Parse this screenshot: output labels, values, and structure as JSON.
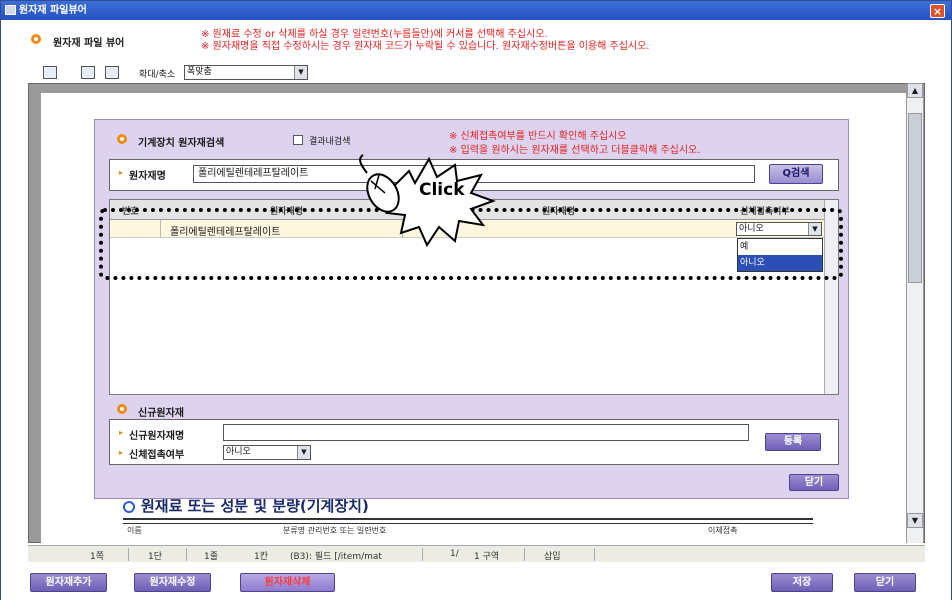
{
  "window": {
    "title": "원자재 파일뷰어",
    "close_label": "×"
  },
  "header": {
    "title": "원자재 파일 뷰어",
    "notices": [
      "※ 원재료 수정 or 삭제를 하실 경우 일련번호(누름들안)에 커서를 선택해 주십시오.",
      "※ 원자재명을 직접 수정하시는 경우 원자재 코드가 누락될 수 있습니다. 원자재수정버튼을 이용해 주십시오."
    ]
  },
  "toolbar": {
    "zoom_label": "확대/축소",
    "zoom_value": "폭맞춤"
  },
  "dialog": {
    "title": "기계장치 원자재검색",
    "result_search_label": "결과내검색",
    "notices": [
      "※ 신체접촉여부를 반드시 확인해 주십시오",
      "※ 입력을 원하시는 원자재를 선택하고 더블클릭해 주십시오."
    ],
    "material_name_label": "원자재명",
    "material_name_value": "폴리에틸렌테레프탈레이트",
    "search_button": "Q검색",
    "grid": {
      "columns": [
        "번호",
        "원자재명",
        "원자재명",
        "신체접촉여부"
      ],
      "rows": [
        {
          "name": "폴리에틸렌테레프탈레이트",
          "code": "",
          "contact": "아니오"
        }
      ]
    },
    "dropdown_options": [
      "예",
      "아니오"
    ],
    "dropdown_selected": "아니오",
    "new_material_section": "신규원자재",
    "new_name_label": "신규원자재명",
    "new_name_value": "",
    "new_contact_label": "신체접촉여부",
    "new_contact_value": "아니오",
    "register_button": "등록",
    "close_button": "닫기"
  },
  "callout": {
    "text": "Click"
  },
  "document": {
    "heading": "원재료 또는 성분 및 분량(기계장치)",
    "row_labels": [
      "이름",
      "분류명 관리번호 또는 일련번호",
      "이체접촉"
    ]
  },
  "statusbar": {
    "items": [
      "1쪽",
      "1단",
      "1줄",
      "1칸",
      "(B3): 필드 [/item/mat",
      "1/",
      "1 구역",
      "삽입"
    ]
  },
  "bottom": {
    "buttons": [
      "원자재추가",
      "원자재수정",
      "원자재삭제",
      "저장",
      "닫기"
    ]
  }
}
